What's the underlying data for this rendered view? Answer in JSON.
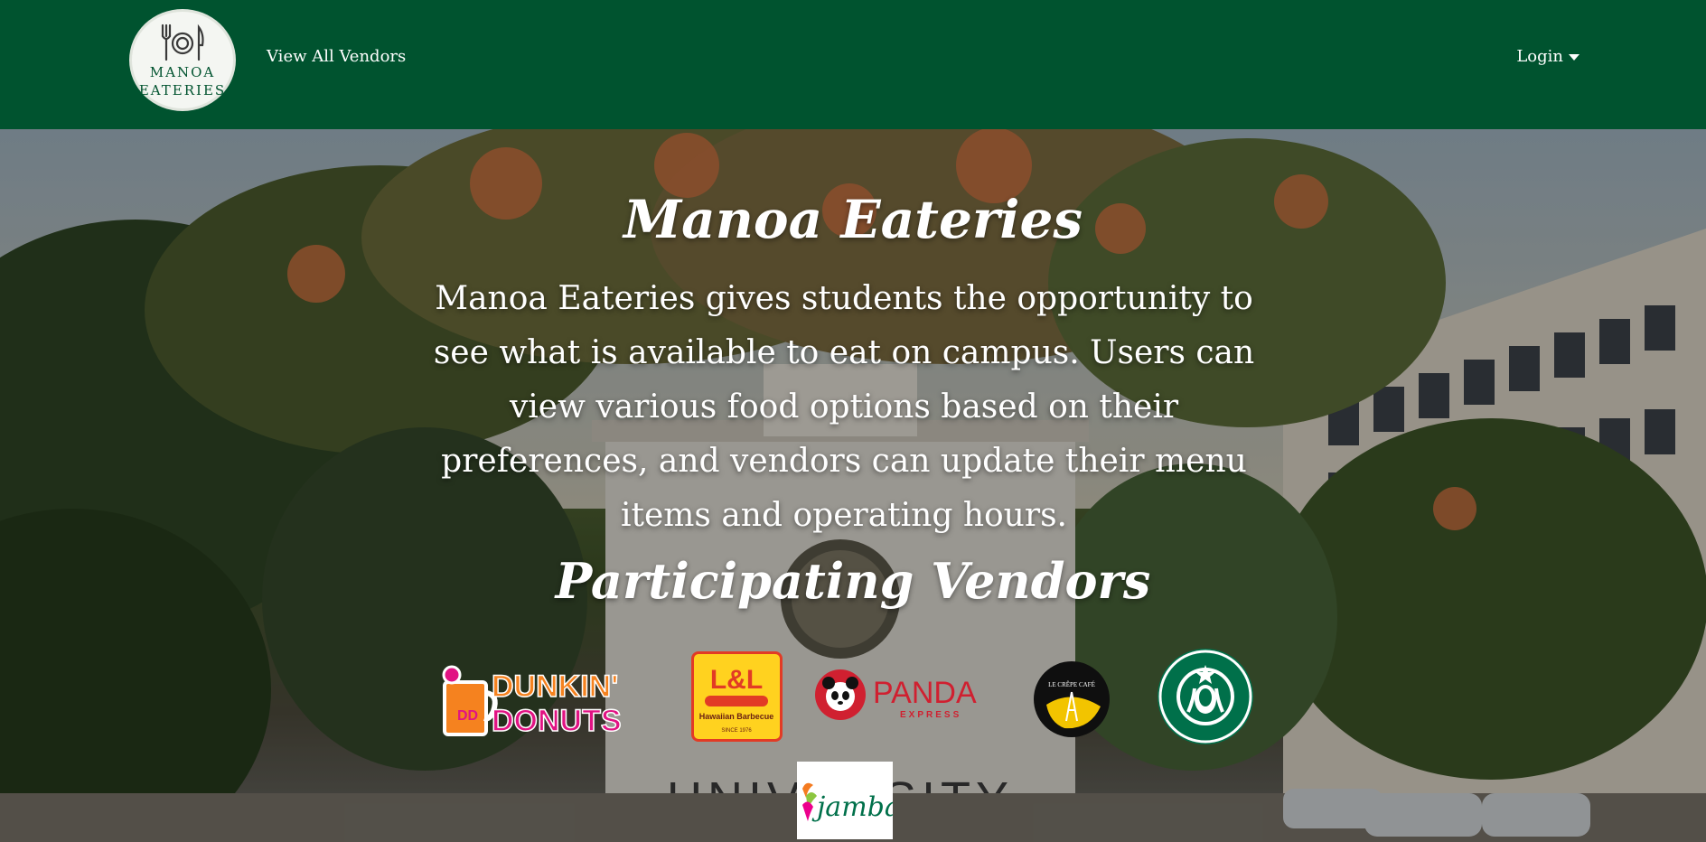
{
  "navbar": {
    "brand_line1": "MANOA",
    "brand_line2": "EATERIES",
    "view_all_vendors": "View All Vendors",
    "login": "Login",
    "bg_color": "#00532f"
  },
  "hero": {
    "title": "Manoa Eateries",
    "description": "Manoa Eateries gives students the opportunity to see what is available to eat on campus. Users can view various food options based on their preferences, and vendors can update their menu items and operating hours.",
    "vendors_heading": "Participating Vendors",
    "background_sign_text": "UNIVERSITY"
  },
  "vendors": [
    {
      "name": "Dunkin' Donuts",
      "logo_line1": "DUNKIN'",
      "logo_line2": "DONUTS",
      "icon": "dunkin-donuts-logo"
    },
    {
      "name": "L&L Hawaiian Barbecue",
      "logo_line1": "L&L",
      "logo_line2": "Hawaiian Barbecue",
      "logo_line3": "SINCE 1976",
      "icon": "ll-hawaiian-barbecue-logo"
    },
    {
      "name": "Panda Express",
      "logo_line1": "PANDA",
      "logo_line2": "EXPRESS",
      "icon": "panda-express-logo"
    },
    {
      "name": "Le Crêpe Café",
      "logo_line1": "LE CRÊPE CAFÉ",
      "icon": "le-crepe-cafe-logo"
    },
    {
      "name": "Starbucks",
      "icon": "starbucks-logo"
    },
    {
      "name": "Jamba",
      "logo_line1": "jamba",
      "icon": "jamba-logo"
    }
  ]
}
